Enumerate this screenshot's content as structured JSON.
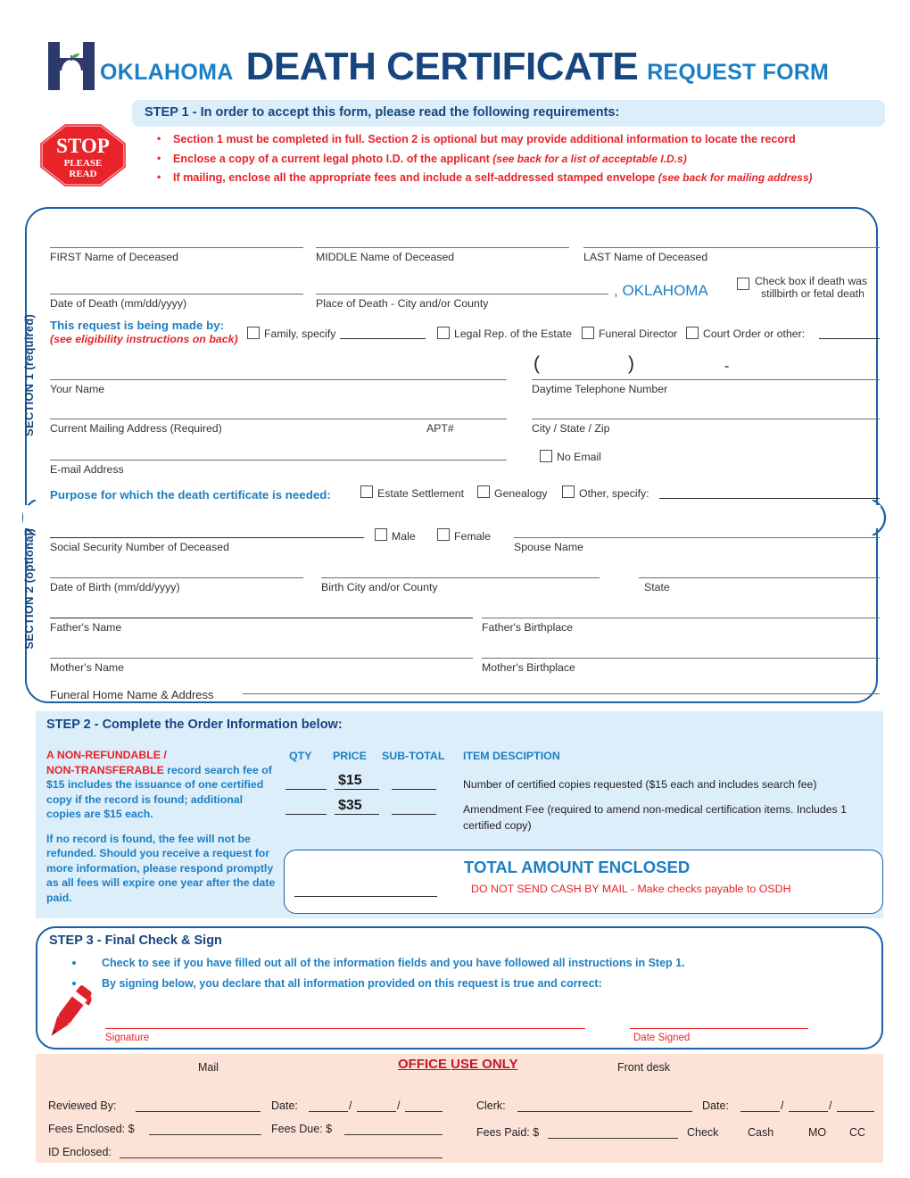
{
  "header": {
    "logo_icon": "oklahoma-health-apple-h-logo",
    "state": "OKLAHOMA",
    "title": "DEATH CERTIFICATE",
    "subtitle": "REQUEST FORM"
  },
  "step1": {
    "banner": "STEP 1 - In order to accept this form, please read the following requirements:",
    "stop_sign": {
      "line1": "STOP",
      "line2": "PLEASE",
      "line3": "READ"
    },
    "bullets": [
      {
        "text": "Section 1 must be completed in full. Section 2 is optional but may provide additional information to locate the record",
        "note": ""
      },
      {
        "text": "Enclose a copy of a current legal photo I.D. of the applicant ",
        "note": "(see back for a list of acceptable I.D.s)"
      },
      {
        "text": "If mailing, enclose all the appropriate fees and include a self-addressed stamped envelope ",
        "note": "(see back for mailing address)"
      }
    ]
  },
  "section1": {
    "vertical_label": "SECTION 1 (required)",
    "first_name": "FIRST Name of Deceased",
    "middle_name": "MIDDLE Name of Deceased",
    "last_name": "LAST Name of Deceased",
    "date_of_death": "Date of Death (mm/dd/yyyy)",
    "place_of_death": "Place of Death - City and/or County",
    "state_fixed": ", OKLAHOMA",
    "stillbirth_l1": "Check box if  death was",
    "stillbirth_l2": "stillbirth or fetal death",
    "made_by_title": "This request is being made by:",
    "made_by_note": "(see eligibility instructions on back)",
    "made_by_options": [
      "Family, specify",
      "Legal Rep. of the Estate",
      "Funeral Director",
      "Court Order or other:"
    ],
    "your_name": "Your Name",
    "phone": "Daytime Telephone Number",
    "mailing_address": "Current Mailing Address (Required)",
    "apt": "APT#",
    "city_state_zip": "City / State / Zip",
    "email": "E-mail Address",
    "no_email": "No Email",
    "purpose_title": "Purpose for which the death certificate is needed:",
    "purpose_options": [
      "Estate Settlement",
      "Genealogy",
      "Other, specify:"
    ]
  },
  "section2": {
    "vertical_label": "SECTION 2 (optional)",
    "ssn": "Social Security Number of Deceased",
    "sex_options": [
      "Male",
      "Female"
    ],
    "spouse": "Spouse Name",
    "dob": "Date of Birth (mm/dd/yyyy)",
    "birth_city": "Birth City and/or County",
    "state": "State",
    "father_name": "Father's Name",
    "father_birthplace": "Father's Birthplace",
    "mother_name": "Mother's Name",
    "mother_birthplace": "Mother's Birthplace",
    "funeral_home": "Funeral Home Name & Address"
  },
  "step2": {
    "title": "STEP 2 - Complete the Order Information below:",
    "notice_p1_red1": "A NON-REFUNDABLE /",
    "notice_p1_red2": "NON-TRANSFERABLE",
    "notice_p1_rest": " record search fee of $15 includes the issuance of one certified copy if the record is found; additional copies are $15 each.",
    "notice_p2": "If no record is found, the fee will not be refunded.  Should you receive a request for more information, please respond promptly as all fees will expire one year after the date paid.",
    "columns": [
      "QTY",
      "PRICE",
      "SUB-TOTAL",
      "ITEM DESCIPTION"
    ],
    "rows": [
      {
        "qty": "",
        "price": "$15",
        "subtotal": "",
        "description": "Number of certified copies requested ($15 each and includes search fee)"
      },
      {
        "qty": "",
        "price": "$35",
        "subtotal": "",
        "description": "Amendment Fee (required to amend non-medical certification items. Includes 1 certified copy)"
      }
    ],
    "total_title": "TOTAL AMOUNT ENCLOSED",
    "total_sub": "DO NOT SEND CASH BY MAIL - Make checks payable to OSDH",
    "total_value": ""
  },
  "step3": {
    "title": "STEP 3 - Final Check & Sign",
    "pen_icon": "red-pen-icon",
    "bullets": [
      "Check to see if you have filled out all of the information fields and you have followed all instructions in Step 1.",
      "By signing below, you declare that all information provided on this request is true and correct:"
    ],
    "signature_label": "Signature",
    "date_signed_label": "Date Signed"
  },
  "office": {
    "title": "OFFICE USE ONLY",
    "mail_label": "Mail",
    "front_desk_label": "Front desk",
    "reviewed_by": "Reviewed By:",
    "date_left": "Date:",
    "fees_enclosed": "Fees Enclosed:  $",
    "fees_due": "Fees Due:  $",
    "id_enclosed": "ID Enclosed:",
    "clerk": "Clerk:",
    "date_right": "Date:",
    "fees_paid": "Fees Paid:  $",
    "payment_types": [
      "Check",
      "Cash",
      "MO",
      "CC"
    ],
    "date_slash": "/"
  },
  "colors": {
    "navy": "#17457f",
    "blue": "#1b7fc4",
    "outline_blue": "#1b5fa8",
    "red": "#e8232a",
    "dark_red": "#c2182b",
    "light_blue_bg": "#dceefa",
    "peach_bg": "#fbe3d7"
  }
}
